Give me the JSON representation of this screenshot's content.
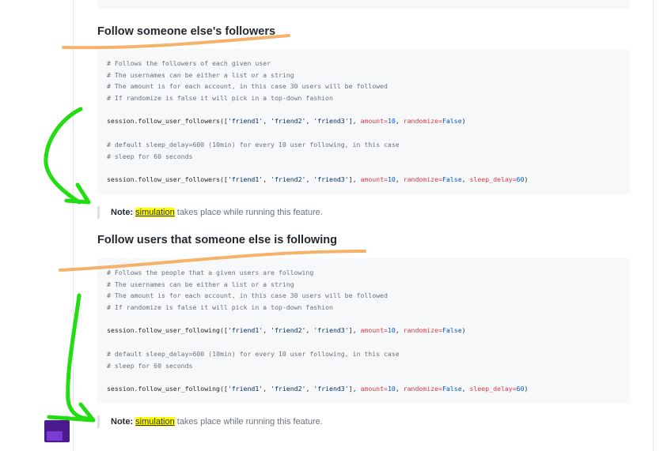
{
  "sections": [
    {
      "title": "Follow someone else's followers",
      "code": {
        "comments_a": [
          "# Follows the followers of each given user",
          "# The usernames can be either a list or a string",
          "# The amount is for each account, in this case 30 users will be followed",
          "# If randomize is false it will pick in a top-down fashion"
        ],
        "call_1": {
          "fn": "session.follow_user_followers(",
          "arg1": "'friend1'",
          "arg2": "'friend2'",
          "arg3": "'friend3'",
          "amount_kw": "amount=",
          "amount_val": "10",
          "randomize_kw": "randomize=",
          "randomize_val": "False"
        },
        "comments_b": [
          "# default sleep_delay=600 (10min) for every 10 user following, in this case",
          "# sleep for 60 seconds"
        ],
        "call_2": {
          "fn": "session.follow_user_followers(",
          "arg1": "'friend1'",
          "arg2": "'friend2'",
          "arg3": "'friend3'",
          "amount_kw": "amount=",
          "amount_val": "10",
          "randomize_kw": "randomize=",
          "randomize_val": "False",
          "sleep_kw": "sleep_delay=",
          "sleep_val": "60"
        }
      },
      "note": {
        "label": "Note:",
        "highlight": "simulation",
        "text": " takes place while running this feature."
      }
    },
    {
      "title": "Follow users that someone else is following",
      "code": {
        "comments_a": [
          "# Follows the people that a given users are following",
          "# The usernames can be either a list or a string",
          "# The amount is for each account, in this case 30 users will be followed",
          "# If randomize is false it will pick in a top-down fashion"
        ],
        "call_1": {
          "fn": "session.follow_user_following(",
          "arg1": "'friend1'",
          "arg2": "'friend2'",
          "arg3": "'friend3'",
          "amount_kw": "amount=",
          "amount_val": "10",
          "randomize_kw": "randomize=",
          "randomize_val": "False"
        },
        "comments_b": [
          "# default sleep_delay=600 (10min) for every 10 user following, in this case",
          "# sleep for 60 seconds"
        ],
        "call_2": {
          "fn": "session.follow_user_following(",
          "arg1": "'friend1'",
          "arg2": "'friend2'",
          "arg3": "'friend3'",
          "amount_kw": "amount=",
          "amount_val": "10",
          "randomize_kw": "randomize=",
          "randomize_val": "False",
          "sleep_kw": "sleep_delay=",
          "sleep_val": "60"
        }
      },
      "note": {
        "label": "Note:",
        "highlight": "simulation",
        "text": " takes place while running this feature."
      }
    }
  ],
  "colors": {
    "underline_annotation": "#f5b26b",
    "arrow_annotation": "#22dd11",
    "highlight": "#ffff00",
    "corner_icon": "#4b1a8c"
  },
  "icons": {
    "corner": "app-tile-icon"
  }
}
